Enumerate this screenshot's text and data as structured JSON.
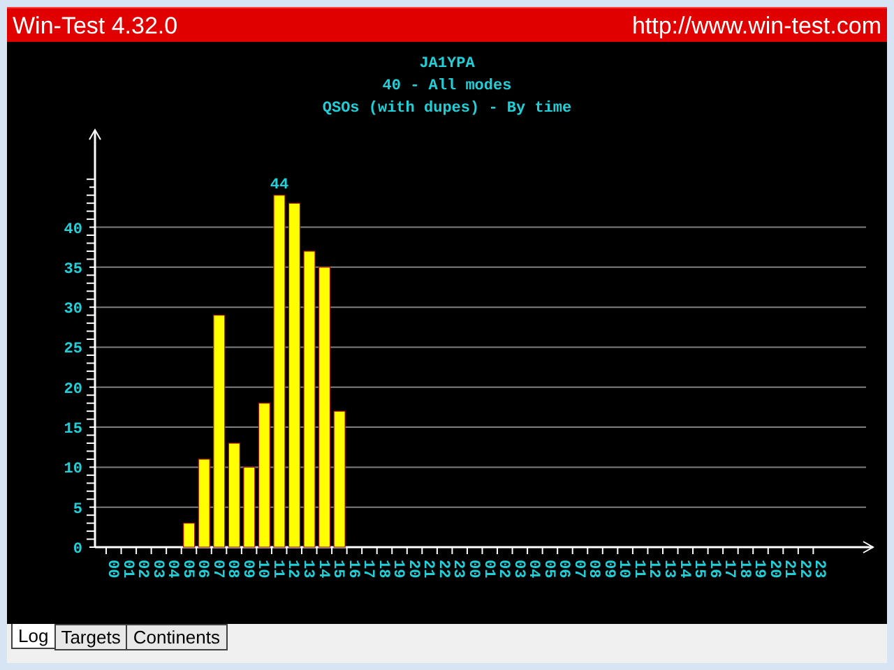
{
  "window": {
    "title": "Win-Test 4.32.0",
    "url": "http://www.win-test.com"
  },
  "heading": [
    "JA1YPA",
    "40 - All modes",
    "QSOs (with dupes) - By time"
  ],
  "chart_data": {
    "type": "bar",
    "categories": [
      "00",
      "01",
      "02",
      "03",
      "04",
      "05",
      "06",
      "07",
      "08",
      "09",
      "10",
      "11",
      "12",
      "13",
      "14",
      "15",
      "16",
      "17",
      "18",
      "19",
      "20",
      "21",
      "22",
      "23",
      "00",
      "01",
      "02",
      "03",
      "04",
      "05",
      "06",
      "07",
      "08",
      "09",
      "10",
      "11",
      "12",
      "13",
      "14",
      "15",
      "16",
      "17",
      "18",
      "19",
      "20",
      "21",
      "22",
      "23"
    ],
    "series": [
      {
        "color": "#ffff00",
        "values": [
          0,
          0,
          0,
          0,
          0,
          3,
          11,
          29,
          13,
          10,
          18,
          44,
          43,
          37,
          35,
          17,
          0,
          0,
          0,
          0,
          0,
          0,
          0,
          0,
          0,
          0,
          0,
          0,
          0,
          0,
          0,
          0,
          0,
          0,
          0,
          0,
          0,
          0,
          0,
          0,
          0,
          0,
          0,
          0,
          0,
          0,
          0,
          0
        ]
      }
    ],
    "ylim": [
      0,
      52
    ],
    "yticks": [
      0,
      5,
      10,
      15,
      20,
      25,
      30,
      35,
      40
    ],
    "grid": true,
    "annotations": [
      "44"
    ]
  },
  "tabs": [
    {
      "label": "Log",
      "selected": true
    },
    {
      "label": "Targets",
      "selected": false
    },
    {
      "label": "Continents",
      "selected": false
    }
  ]
}
